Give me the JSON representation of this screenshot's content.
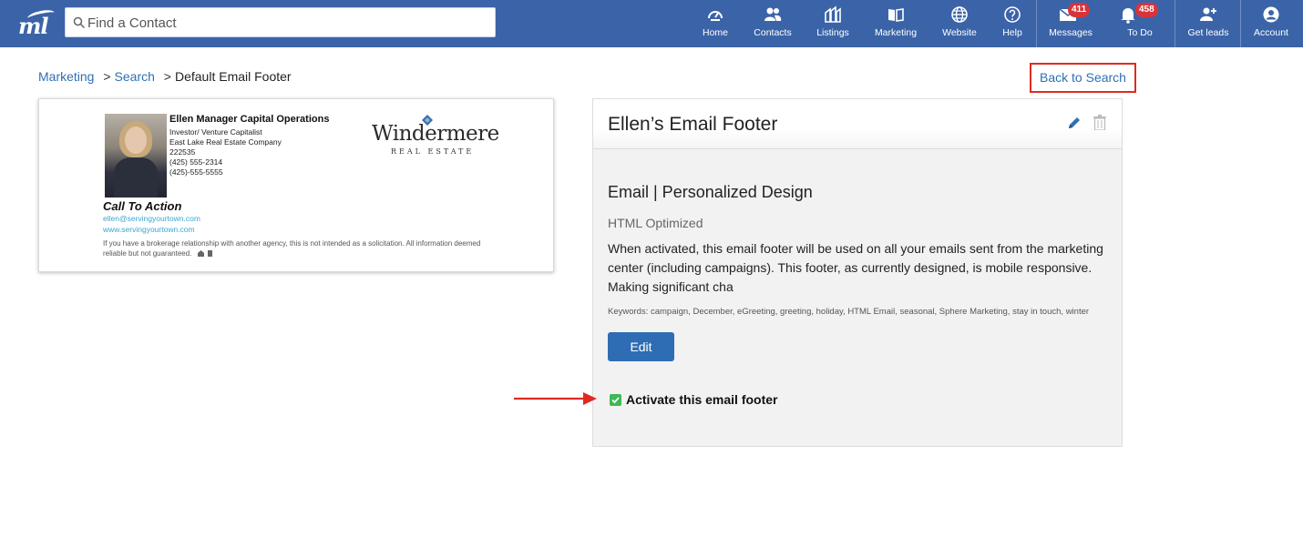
{
  "header": {
    "logo_text": "ml",
    "search": {
      "placeholder": "Find a Contact"
    },
    "nav": [
      {
        "label": "Home",
        "icon": "dashboard-icon"
      },
      {
        "label": "Contacts",
        "icon": "people-icon"
      },
      {
        "label": "Listings",
        "icon": "buildings-icon"
      },
      {
        "label": "Marketing",
        "icon": "book-icon"
      },
      {
        "label": "Website",
        "icon": "globe-icon"
      },
      {
        "label": "Help",
        "icon": "question-icon"
      },
      {
        "label": "Messages",
        "icon": "envelope-icon",
        "badge": "411"
      },
      {
        "label": "To Do",
        "icon": "bell-icon",
        "badge": "458"
      },
      {
        "label": "Get leads",
        "icon": "add-person-icon"
      },
      {
        "label": "Account",
        "icon": "account-icon"
      }
    ]
  },
  "breadcrumb": {
    "items": [
      "Marketing",
      "Search"
    ],
    "current": "Default Email Footer",
    "separator": ">"
  },
  "back_to_search": "Back to Search",
  "preview": {
    "name": "Ellen Manager Capital Operations",
    "lines": [
      "Investor/ Venture Capitalist",
      "East Lake Real Estate Company",
      "222535",
      "(425) 555-2314",
      "(425)-555-5555"
    ],
    "brand": "Windermere",
    "brand_sub": "REAL ESTATE",
    "cta": "Call To Action",
    "email": "ellen@servingyourtown.com",
    "website": "www.servingyourtown.com",
    "disclaimer": "If you have a brokerage relationship with another agency, this is not intended as a solicitation. All information deemed reliable but not guaranteed."
  },
  "panel": {
    "title": "Ellen’s Email Footer",
    "design": "Email | Personalized Design",
    "optimization": "HTML Optimized",
    "description": "When activated, this email footer will be used on all your emails sent from the marketing center (including campaigns). This footer, as currently designed, is mobile responsive. Making significant cha",
    "keywords": "Keywords: campaign, December, eGreeting, greeting, holiday, HTML Email, seasonal, Sphere Marketing, stay in touch, winter",
    "edit_button": "Edit",
    "activate_label": "Activate this email footer",
    "activate_checked": true
  },
  "colors": {
    "header_bg": "#3b64a8",
    "link": "#2f6fb5",
    "button": "#2e6db4",
    "badge": "#d9333a",
    "highlight": "#e02a20",
    "checkbox": "#3cba54"
  }
}
